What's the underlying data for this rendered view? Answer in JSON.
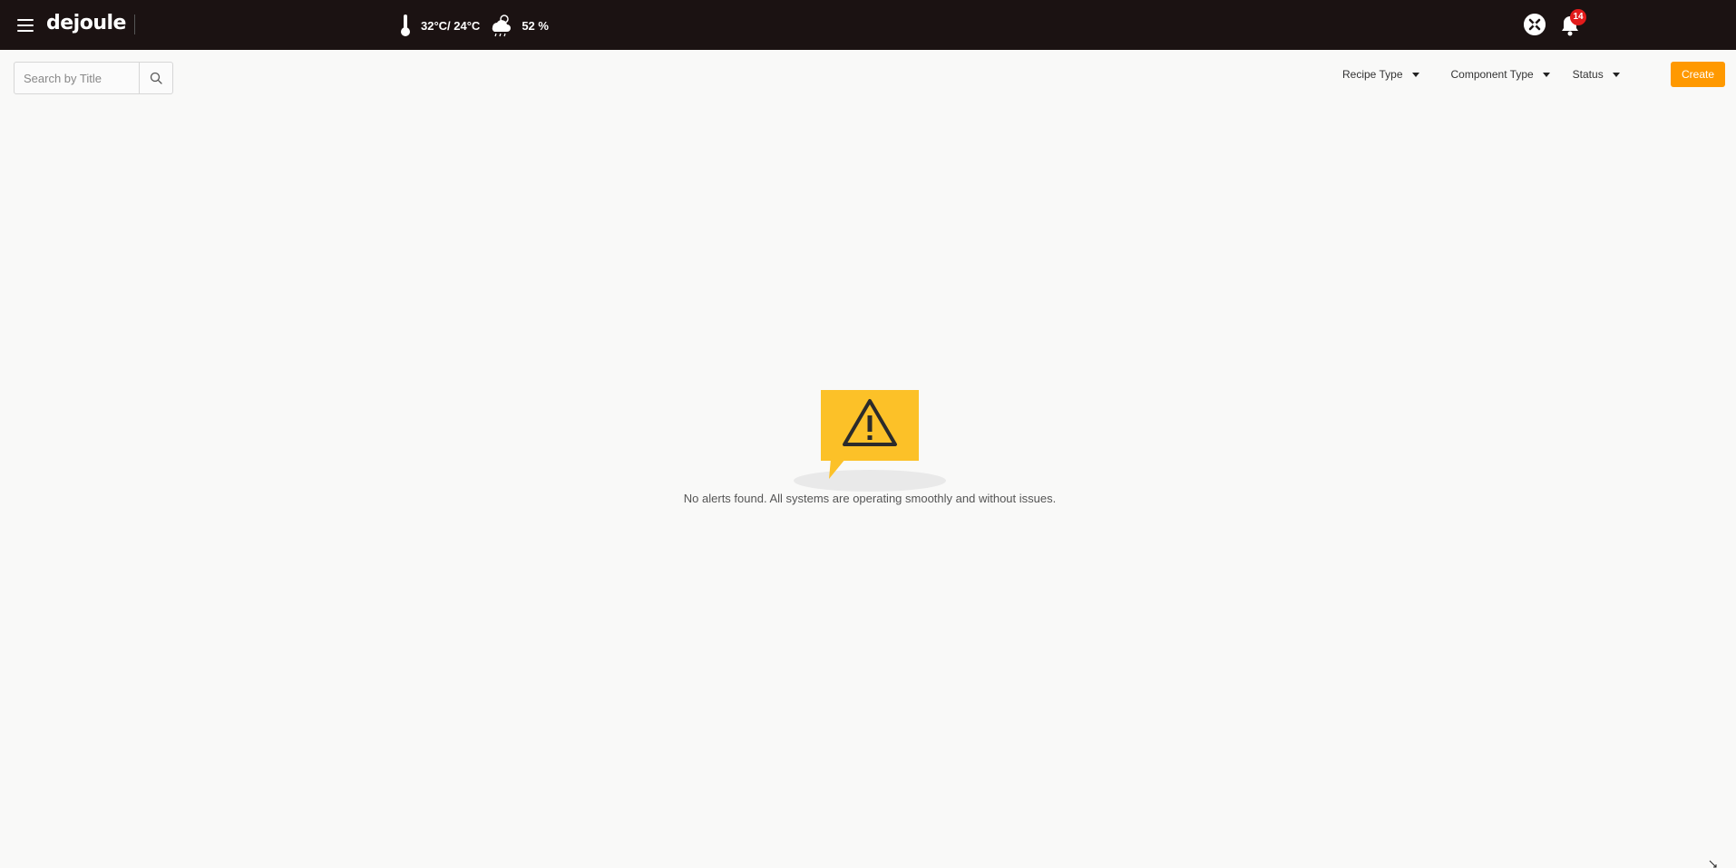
{
  "header": {
    "logo_text": "dejoule",
    "temperature": "32°C/ 24°C",
    "humidity": "52 %",
    "notification_count": "14",
    "icons": [
      "menu-icon",
      "thermometer-icon",
      "weather-cloud-rain-icon",
      "tools-icon",
      "bell-icon"
    ]
  },
  "toolbar": {
    "search_placeholder": "Search by Title",
    "filters": {
      "recipe_type": "Recipe Type",
      "component_type": "Component Type",
      "status": "Status"
    },
    "create_label": "Create"
  },
  "empty_state": {
    "message": "No alerts found. All systems are operating smoothly and without issues."
  },
  "colors": {
    "topbar_bg": "#1b1212",
    "accent": "#ff9900",
    "warning_yellow": "#fcc128",
    "badge_red": "#e21b1b",
    "page_bg": "#f9f9f8"
  }
}
